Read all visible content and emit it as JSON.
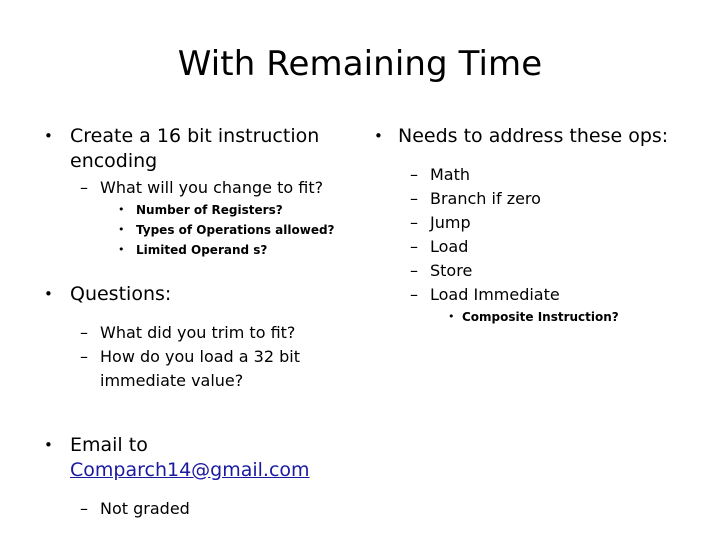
{
  "slide": {
    "title": "With Remaining Time",
    "background_color": "#ffffff",
    "text_color": "#000000",
    "hyperlink_color": "#1a1aa0",
    "bullet_glyphs": {
      "level1": "•",
      "level2": "–",
      "level3": "•"
    },
    "left_column": {
      "group_encoding": {
        "heading": "Create a 16 bit instruction encoding",
        "sub": "What will you change to fit?",
        "details": [
          "Number of Registers?",
          "Types of Operations allowed?",
          "Limited Operand s?"
        ]
      },
      "group_questions": {
        "heading": "Questions:",
        "items": [
          "What did you trim to fit?",
          "How do you load a 32 bit immediate value?"
        ]
      },
      "group_email": {
        "heading_prefix": "Email to ",
        "email_link": "Comparch14@gmail.com",
        "note": "Not graded"
      }
    },
    "right_column": {
      "heading": "Needs to address these ops:",
      "ops": [
        "Math",
        "Branch if zero",
        "Jump",
        "Load",
        "Store",
        "Load Immediate"
      ],
      "sub_note": "Composite Instruction?"
    }
  }
}
